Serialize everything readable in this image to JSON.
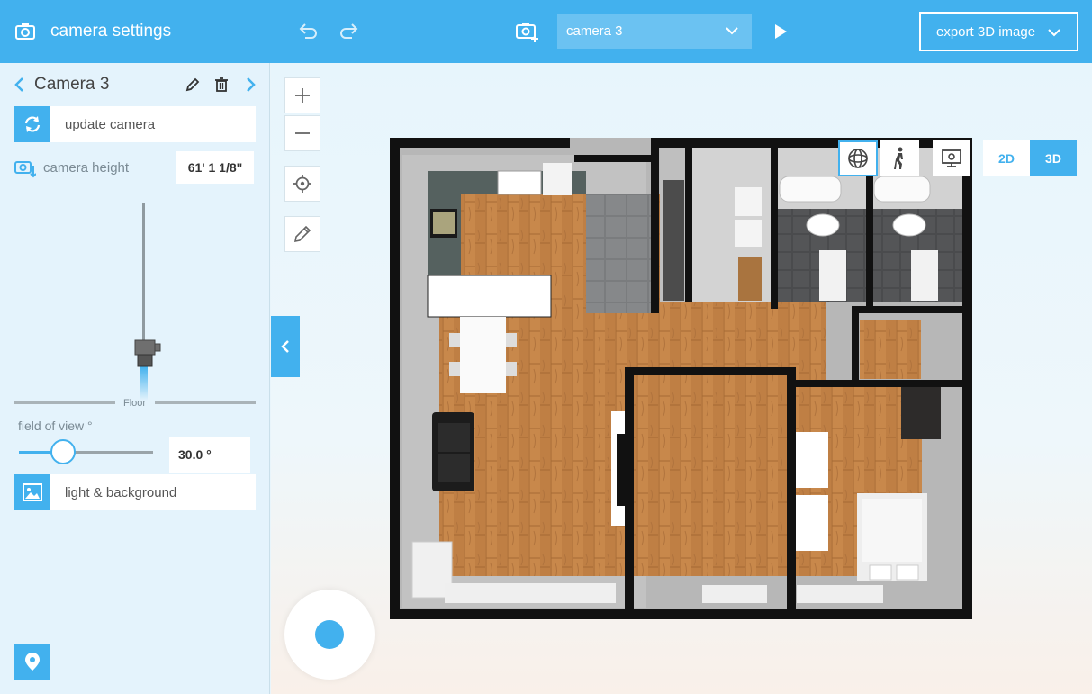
{
  "panel": {
    "title": "camera settings",
    "camera_name": "Camera 3",
    "update_label": "update camera",
    "height_label": "camera height",
    "height_value": "61' 1 1/8\"",
    "floor_label": "Floor",
    "fov_label": "field of view °",
    "fov_value": "30.0 °",
    "fov_slider_fraction": 0.33,
    "light_label": "light & background"
  },
  "toolbar": {
    "camera_select_value": "camera 3",
    "export_label": "export 3D image"
  },
  "view": {
    "mode_2d": "2D",
    "mode_3d": "3D",
    "active_mode": "3D"
  },
  "colors": {
    "accent": "#42b1ee",
    "panel_bg": "#e4f3fc",
    "wall": "#111111",
    "wood": "#c7874a"
  }
}
